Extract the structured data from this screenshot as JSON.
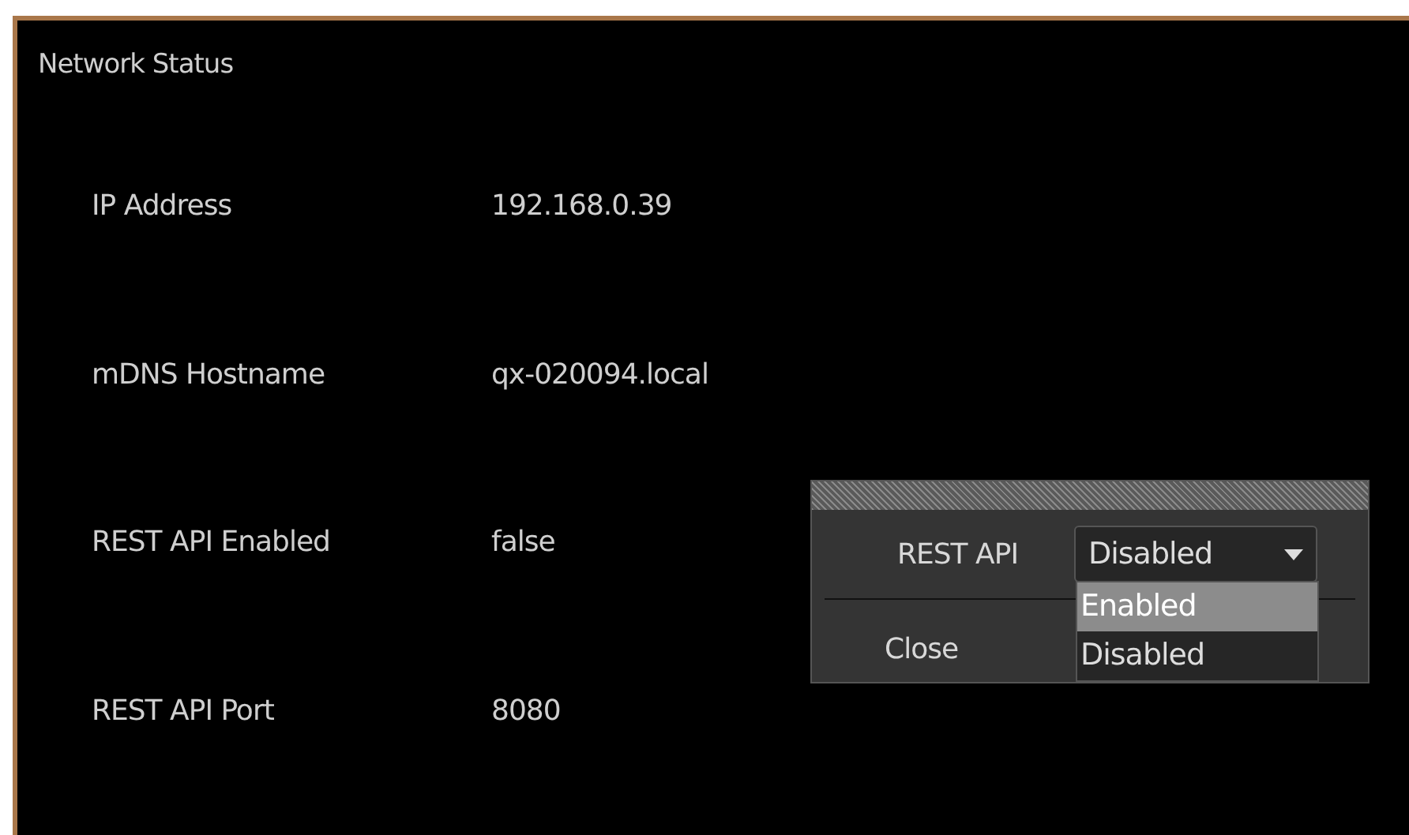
{
  "panel": {
    "title": "Network Status"
  },
  "rows": [
    {
      "label": "IP Address",
      "value": "192.168.0.39"
    },
    {
      "label": "mDNS Hostname",
      "value": "qx-020094.local"
    },
    {
      "label": "REST API Enabled",
      "value": "false"
    },
    {
      "label": "REST API Port",
      "value": "8080"
    }
  ],
  "dialog": {
    "label": "REST API",
    "dropdown": {
      "value": "Disabled",
      "expanded": true,
      "options": [
        {
          "label": "Enabled",
          "highlighted": true
        },
        {
          "label": "Disabled",
          "highlighted": false
        }
      ]
    },
    "close": "Close"
  }
}
